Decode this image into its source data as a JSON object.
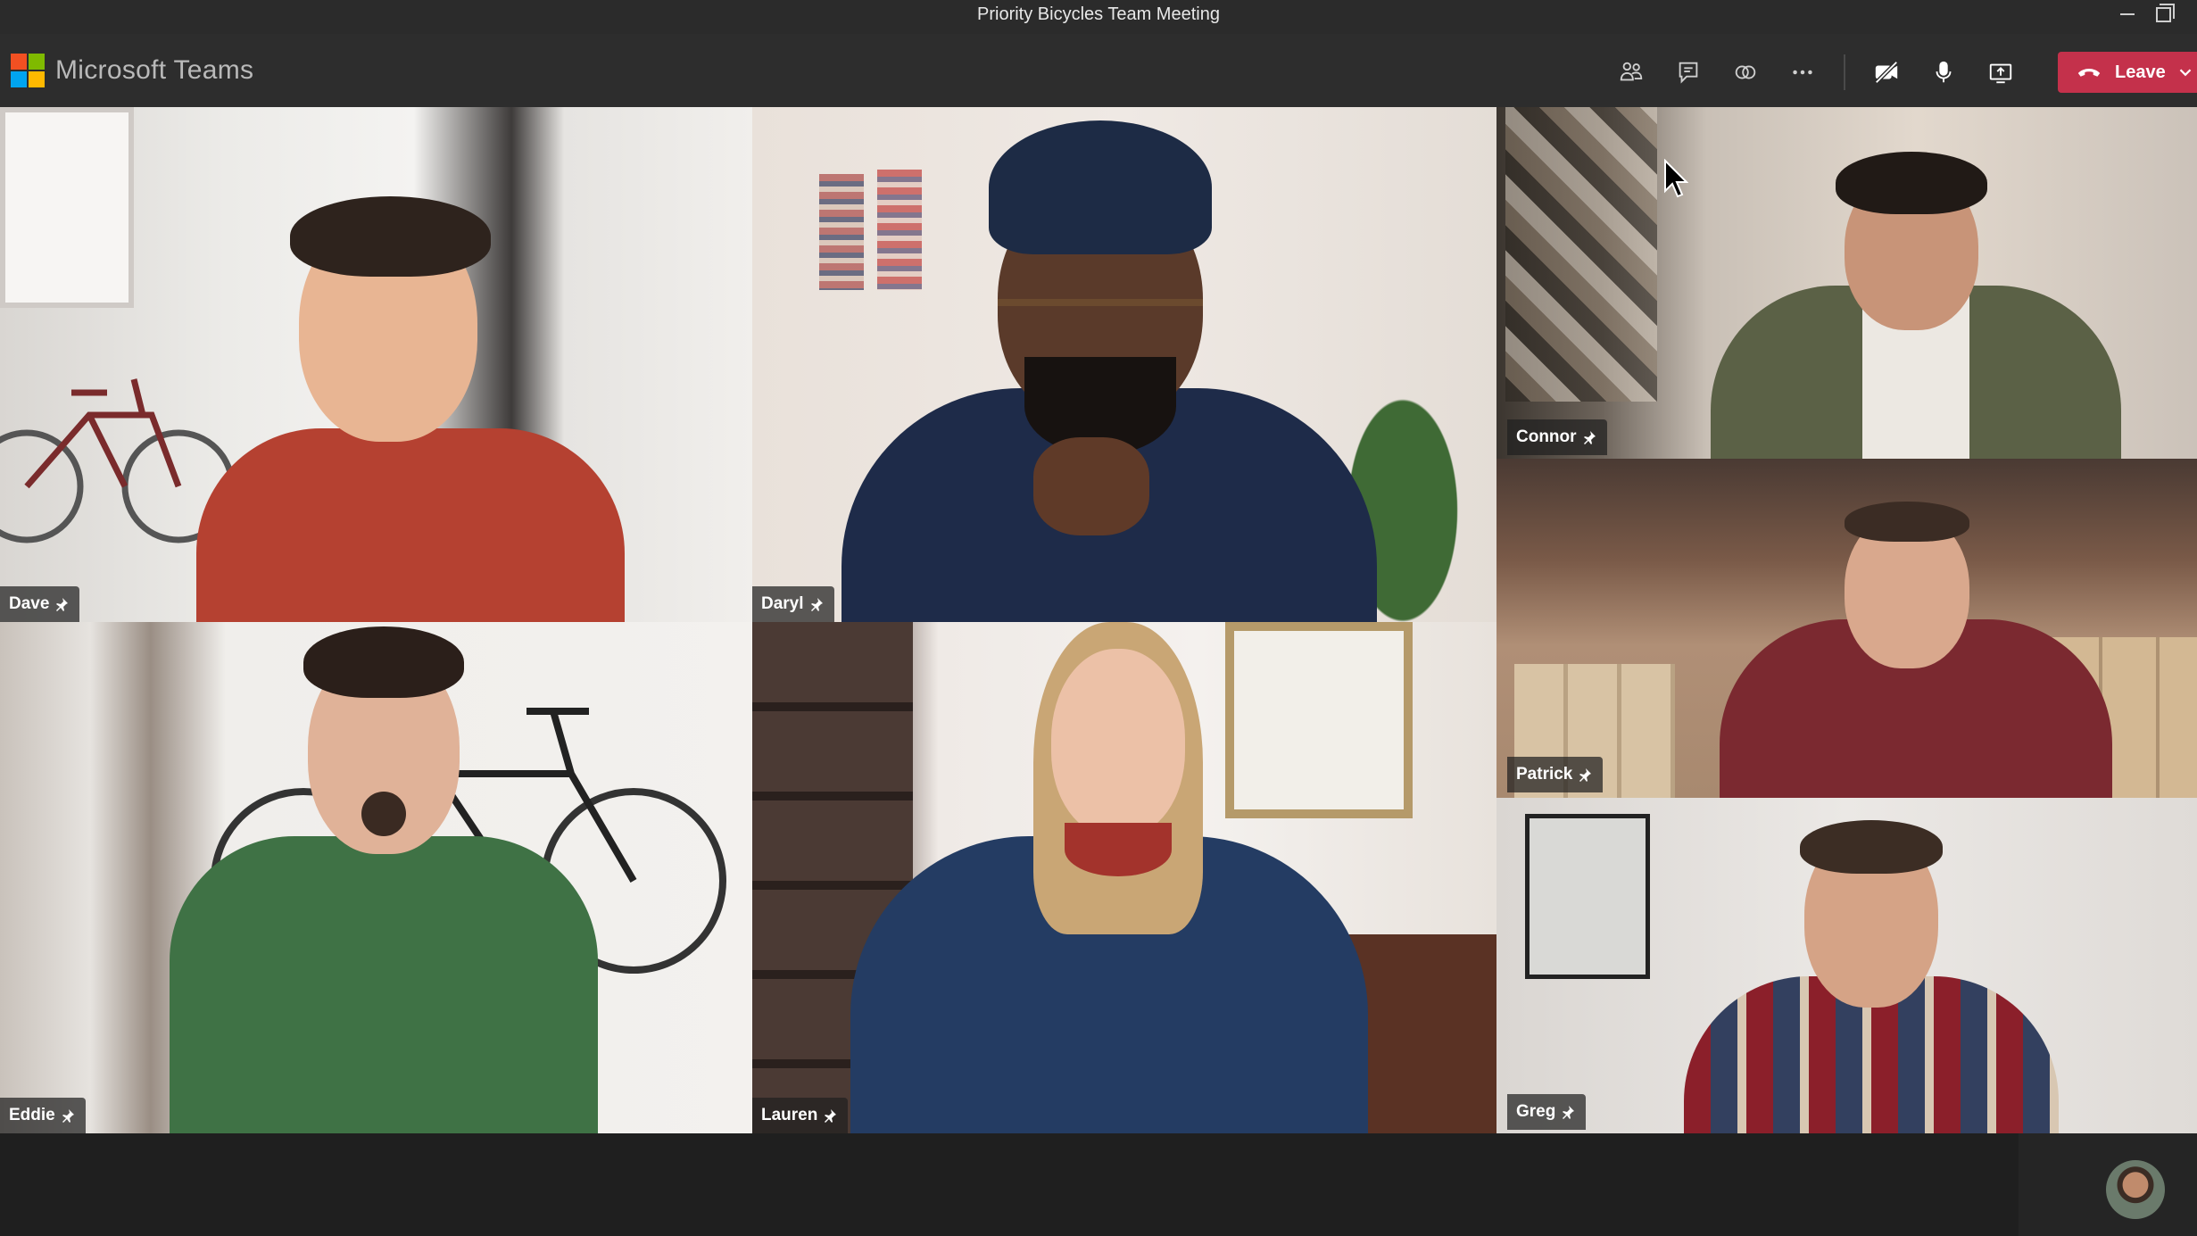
{
  "window": {
    "title": "Priority Bicycles Team Meeting"
  },
  "app": {
    "name": "Microsoft Teams"
  },
  "toolbar": {
    "tools": [
      {
        "name": "participants-icon"
      },
      {
        "name": "chat-icon"
      },
      {
        "name": "reactions-icon"
      },
      {
        "name": "more-options-icon"
      },
      {
        "name": "camera-off-icon"
      },
      {
        "name": "microphone-icon"
      },
      {
        "name": "share-screen-icon"
      }
    ],
    "leave_label": "Leave",
    "leave_color": "#c4314b"
  },
  "participants": [
    {
      "name": "Dave"
    },
    {
      "name": "Daryl"
    },
    {
      "name": "Connor"
    },
    {
      "name": "Patrick"
    },
    {
      "name": "Eddie"
    },
    {
      "name": "Lauren"
    },
    {
      "name": "Greg"
    }
  ],
  "colors": {
    "titlebar": "#2b2b2b",
    "appbar": "#2d2d2d",
    "stage": "#1f1f1f",
    "accent_leave": "#c4314b"
  }
}
